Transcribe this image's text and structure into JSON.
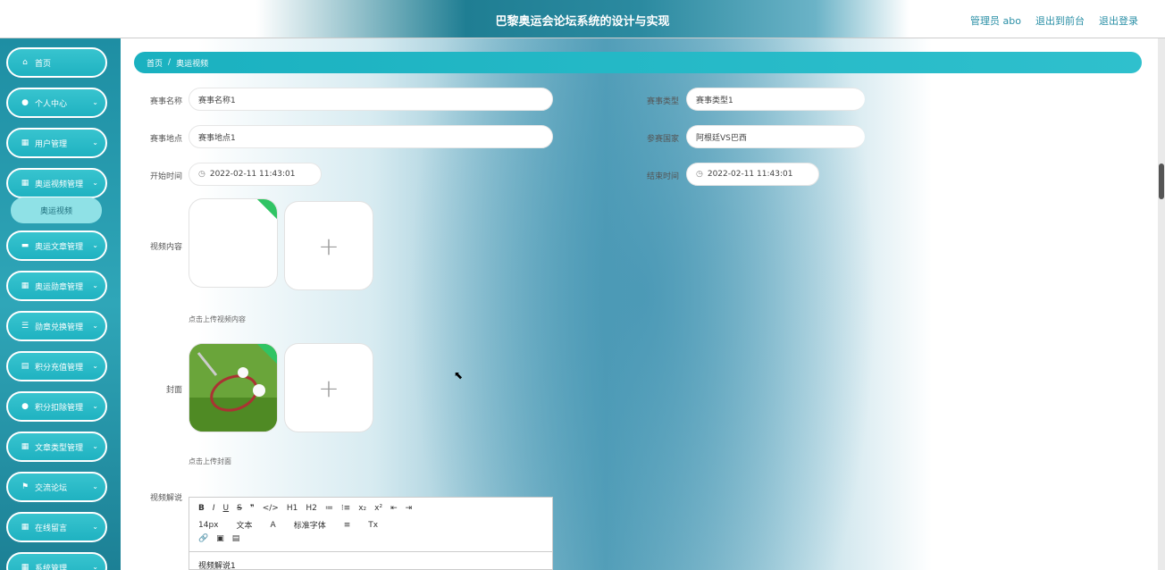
{
  "header": {
    "title": "巴黎奥运会论坛系统的设计与实现",
    "admin": "管理员 abo",
    "back_front": "退出到前台",
    "logout": "退出登录"
  },
  "sidebar": {
    "items": [
      {
        "label": "首页",
        "icon": "home-icon"
      },
      {
        "label": "个人中心",
        "icon": "user-icon"
      },
      {
        "label": "用户管理",
        "icon": "grid-icon"
      },
      {
        "label": "奥运视频管理",
        "icon": "grid-icon"
      },
      {
        "label": "奥运文章管理",
        "icon": "monitor-icon"
      },
      {
        "label": "奥运勋章管理",
        "icon": "grid-icon"
      },
      {
        "label": "勋章兑换管理",
        "icon": "list-icon"
      },
      {
        "label": "积分充值管理",
        "icon": "clipboard-icon"
      },
      {
        "label": "积分扣除管理",
        "icon": "pin-icon"
      },
      {
        "label": "文章类型管理",
        "icon": "grid-icon"
      },
      {
        "label": "交流论坛",
        "icon": "flag-icon"
      },
      {
        "label": "在线留言",
        "icon": "grid-icon"
      },
      {
        "label": "系统管理",
        "icon": "grid-icon"
      }
    ],
    "submenu_active": "奥运视频"
  },
  "breadcrumb": {
    "home": "首页",
    "sep": "/",
    "current": "奥运视频"
  },
  "form": {
    "event_name_label": "赛事名称",
    "event_name_value": "赛事名称1",
    "event_type_label": "赛事类型",
    "event_type_value": "赛事类型1",
    "event_place_label": "赛事地点",
    "event_place_value": "赛事地点1",
    "countries_label": "参赛国家",
    "countries_value": "阿根廷VS巴西",
    "start_label": "开始时间",
    "start_value": "2022-02-11 11:43:01",
    "end_label": "结束时间",
    "end_value": "2022-02-11 11:43:01",
    "video_label": "视频内容",
    "video_hint": "点击上传视频内容",
    "cover_label": "封面",
    "cover_hint": "点击上传封面",
    "desc_label": "视频解说",
    "desc_value": "视频解说1"
  },
  "editor": {
    "row1": [
      "B",
      "I",
      "U",
      "S",
      "❞",
      "</>",
      "H1",
      "H2",
      "≔",
      "⁝≡",
      "x₂",
      "x²",
      "⇤",
      "⇥"
    ],
    "font_size": "14px",
    "text_style": "文本",
    "font_family": "标准字体",
    "colors": {
      "accent": "#1fb2c1",
      "header": "#1f7e93"
    }
  }
}
